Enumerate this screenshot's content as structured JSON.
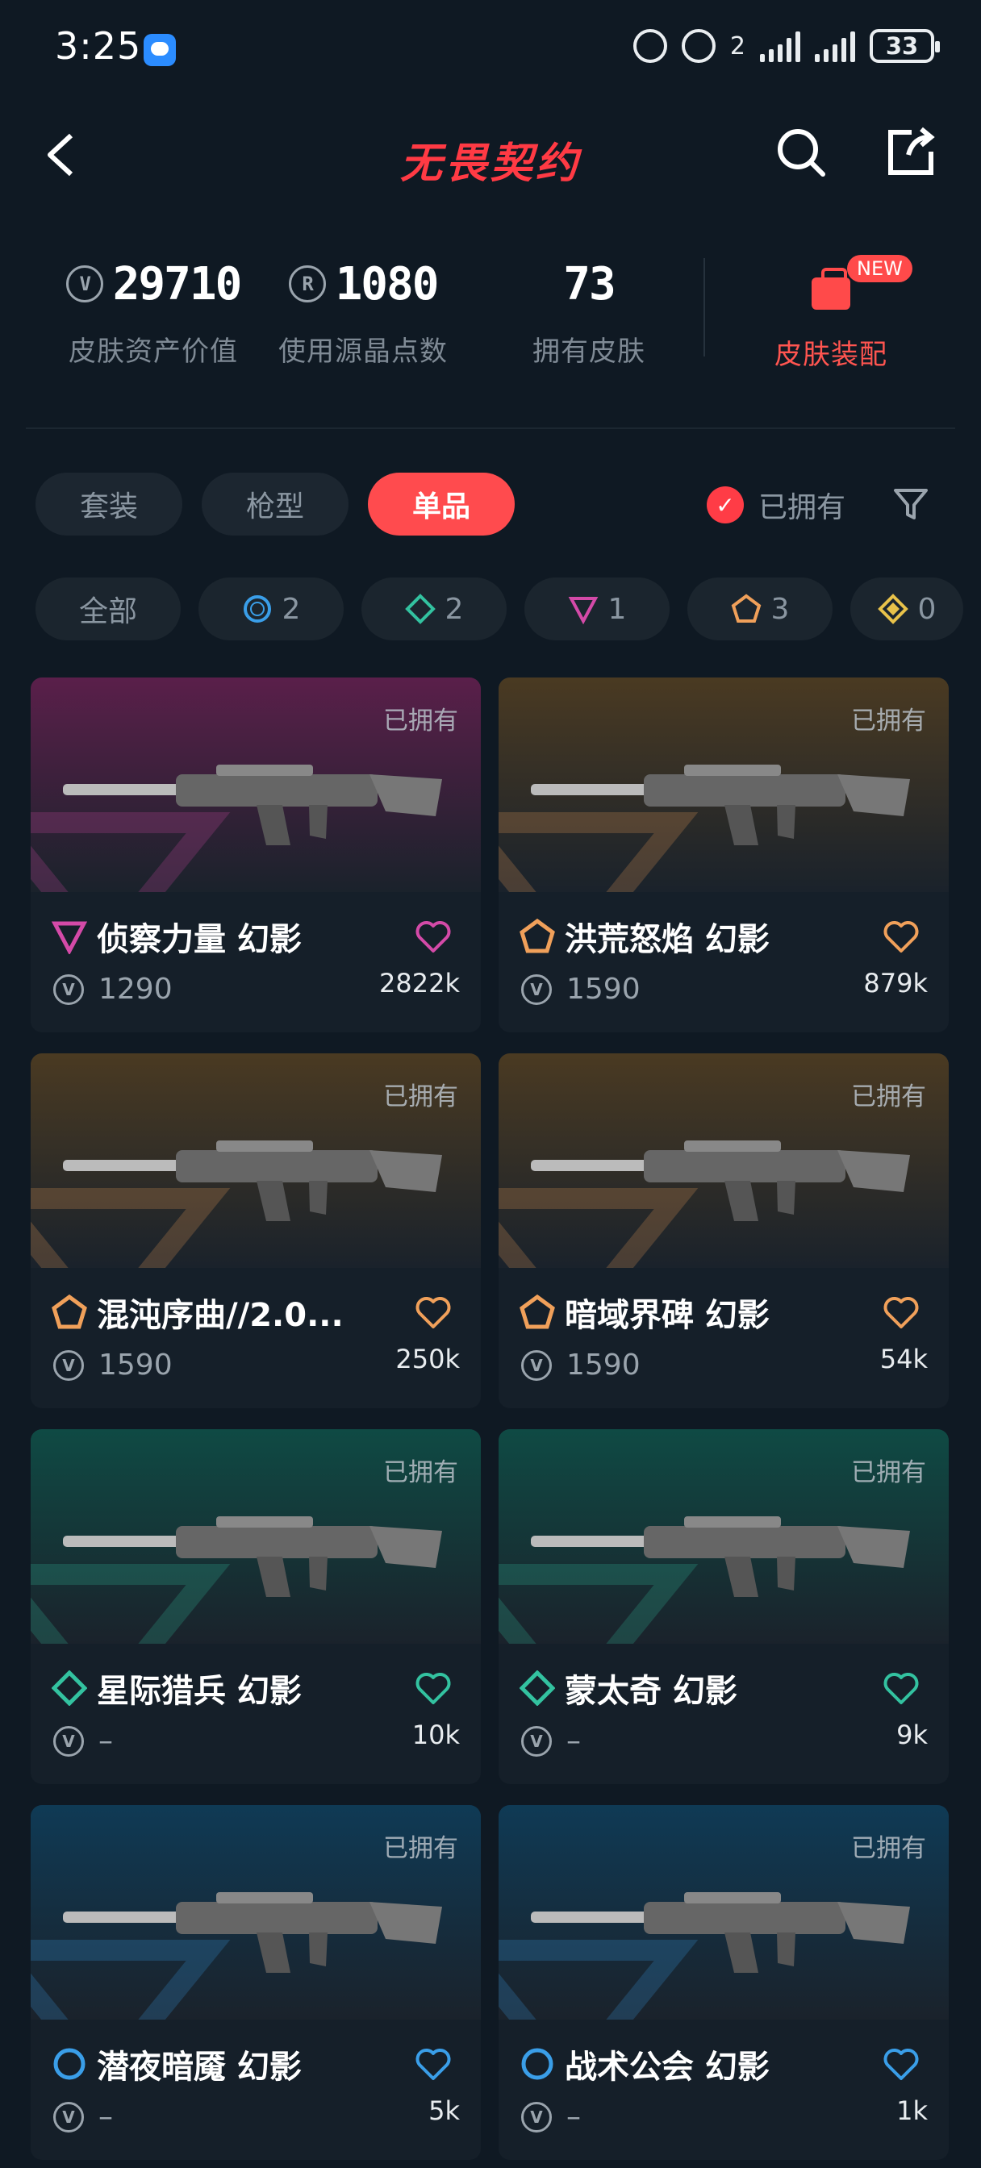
{
  "status_bar": {
    "time": "3:25",
    "signal_label": "2",
    "battery": "33"
  },
  "header": {
    "title": "无畏契约"
  },
  "stats": [
    {
      "value": "29710",
      "label": "皮肤资产价值"
    },
    {
      "value": "1080",
      "label": "使用源晶点数"
    },
    {
      "value": "73",
      "label": "拥有皮肤"
    }
  ],
  "equip": {
    "label": "皮肤装配",
    "badge": "NEW"
  },
  "tabs": [
    "套装",
    "枪型",
    "单品"
  ],
  "active_tab": "单品",
  "owned_filter": {
    "label": "已拥有",
    "checked": true
  },
  "tier_chips": [
    {
      "label": "全部"
    },
    {
      "count": "2",
      "tier": "blue-circle"
    },
    {
      "count": "2",
      "tier": "teal-diamond"
    },
    {
      "count": "1",
      "tier": "pink-triangle"
    },
    {
      "count": "3",
      "tier": "orange-pentagon"
    },
    {
      "count": "0",
      "tier": "gold-diamond"
    }
  ],
  "cards": [
    {
      "owned": "已拥有",
      "name": "侦察力量 幻影",
      "price": "1290",
      "likes": "2822k",
      "tier": "pink-triangle",
      "bg": "#5a1f4a",
      "accent": "#d44aa8"
    },
    {
      "owned": "已拥有",
      "name": "洪荒怒焰 幻影",
      "price": "1590",
      "likes": "879k",
      "tier": "orange-pentagon",
      "bg": "#4a3a22",
      "accent": "#f0a05a"
    },
    {
      "owned": "已拥有",
      "name": "混沌序曲//2.0...",
      "price": "1590",
      "likes": "250k",
      "tier": "orange-pentagon",
      "bg": "#4a3a22",
      "accent": "#f0a05a"
    },
    {
      "owned": "已拥有",
      "name": "暗域界碑 幻影",
      "price": "1590",
      "likes": "54k",
      "tier": "orange-pentagon",
      "bg": "#4a3a22",
      "accent": "#f0a05a"
    },
    {
      "owned": "已拥有",
      "name": "星际猎兵 幻影",
      "price": "–",
      "likes": "10k",
      "tier": "teal-diamond",
      "bg": "#0f4a44",
      "accent": "#33c2a0"
    },
    {
      "owned": "已拥有",
      "name": "蒙太奇 幻影",
      "price": "–",
      "likes": "9k",
      "tier": "teal-diamond",
      "bg": "#0f4a44",
      "accent": "#33c2a0"
    },
    {
      "owned": "已拥有",
      "name": "潜夜暗魇 幻影",
      "price": "–",
      "likes": "5k",
      "tier": "blue-circle",
      "bg": "#0f3a55",
      "accent": "#3a9ee8"
    },
    {
      "owned": "已拥有",
      "name": "战术公会 幻影",
      "price": "–",
      "likes": "1k",
      "tier": "blue-circle",
      "bg": "#0f3a55",
      "accent": "#3a9ee8"
    }
  ]
}
